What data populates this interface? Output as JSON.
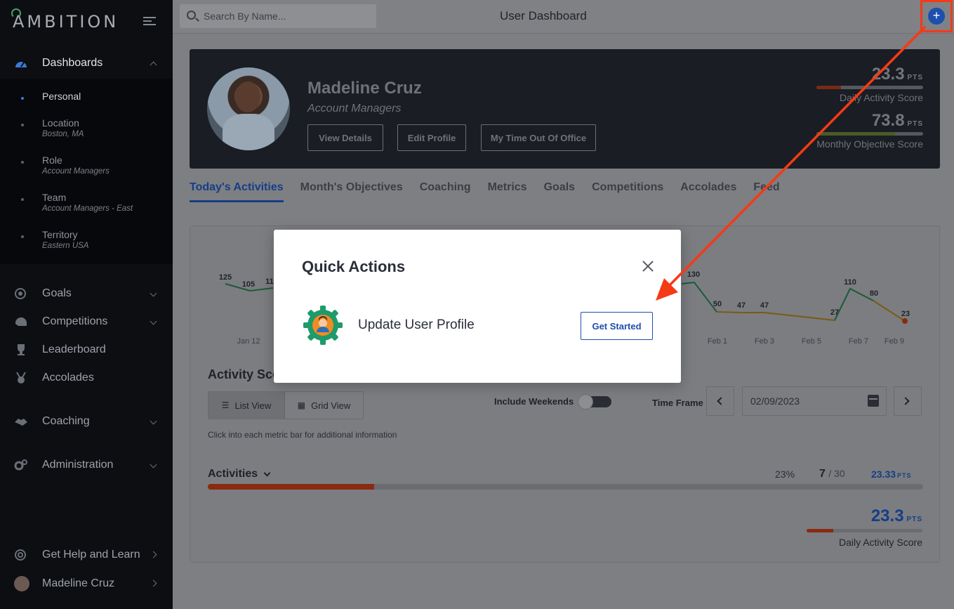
{
  "app": {
    "logo_text": "AMBITION",
    "page_title": "User Dashboard",
    "search_placeholder": "Search By Name..."
  },
  "colors": {
    "accent_blue": "#1d4fae",
    "highlight_red": "#f53a16",
    "brand_green": "#3fa36a"
  },
  "sidebar": {
    "dashboards_label": "Dashboards",
    "sub_items": [
      {
        "title": "Personal",
        "sub": ""
      },
      {
        "title": "Location",
        "sub": "Boston, MA"
      },
      {
        "title": "Role",
        "sub": "Account Managers"
      },
      {
        "title": "Team",
        "sub": "Account Managers - East"
      },
      {
        "title": "Territory",
        "sub": "Eastern USA"
      }
    ],
    "items": [
      {
        "label": "Goals",
        "icon": "target-icon"
      },
      {
        "label": "Competitions",
        "icon": "helmet-icon"
      },
      {
        "label": "Leaderboard",
        "icon": "trophy-icon"
      },
      {
        "label": "Accolades",
        "icon": "medal-icon"
      },
      {
        "label": "Coaching",
        "icon": "handshake-icon"
      },
      {
        "label": "Administration",
        "icon": "gears-icon"
      }
    ],
    "help_label": "Get Help and Learn",
    "user_label": "Madeline Cruz"
  },
  "profile": {
    "name": "Madeline Cruz",
    "role": "Account Managers",
    "buttons": [
      "View Details",
      "Edit Profile",
      "My Time Out Of Office"
    ],
    "daily_score": "23.3",
    "daily_label": "Daily Activity Score",
    "daily_fraction": 0.233,
    "monthly_score": "73.8",
    "monthly_label": "Monthly Objective Score",
    "monthly_fraction": 0.738,
    "pts_unit": "PTS"
  },
  "tabs": [
    "Today's Activities",
    "Month's Objectives",
    "Coaching",
    "Metrics",
    "Goals",
    "Competitions",
    "Accolades",
    "Feed"
  ],
  "chart_data": {
    "type": "line",
    "x_visible_labels": [
      "Jan 12",
      "Feb 1",
      "Feb 3",
      "Feb 5",
      "Feb 7",
      "Feb 9"
    ],
    "visible_point_labels": {
      "left": [
        "125",
        "105",
        "11"
      ],
      "right": [
        "130",
        "50",
        "47",
        "47",
        "27",
        "110",
        "80",
        "23"
      ]
    }
  },
  "activity": {
    "title": "Activity Sco",
    "list_view": "List View",
    "grid_view": "Grid View",
    "include_weekends": "Include Weekends",
    "time_frame": "Time Frame",
    "date": "02/09/2023",
    "hint": "Click into each metric bar for additional information",
    "activities_label": "Activities",
    "percent": "23%",
    "count": "7",
    "count_total": "/ 30",
    "points": "23.33",
    "pts_unit": "PTS",
    "progress_fraction": 0.233,
    "bottom_score": "23.3",
    "bottom_label": "Daily Activity Score"
  },
  "modal": {
    "title": "Quick Actions",
    "action_label": "Update User Profile",
    "action_button": "Get Started"
  }
}
